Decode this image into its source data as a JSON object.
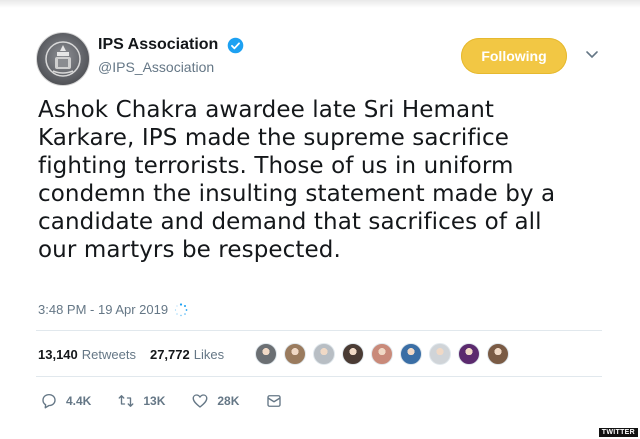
{
  "account": {
    "display_name": "IPS Association",
    "handle": "@IPS_Association",
    "verified": true,
    "avatar_icon": "police-emblem-icon"
  },
  "follow_button": {
    "label": "Following",
    "color": "#f2c744"
  },
  "menu": {
    "icon": "chevron-down-icon"
  },
  "tweet": {
    "lines": [
      "Ashok Chakra awardee late Sri Hemant",
      "Karkare, IPS made the supreme sacrifice",
      "fighting terrorists. Those of us in uniform",
      "condemn the insulting statement made by a",
      "candidate and demand that sacrifices of all",
      "our martyrs be respected."
    ],
    "timestamp": "3:48 PM - 19 Apr 2019"
  },
  "stats": {
    "retweets_count": "13,140",
    "retweets_label": "Retweets",
    "likes_count": "27,772",
    "likes_label": "Likes"
  },
  "liker_avatars": [
    {
      "color": "#6b6f73"
    },
    {
      "color": "#9a7b5e"
    },
    {
      "color": "#b8bec4"
    },
    {
      "color": "#4a3b34"
    },
    {
      "color": "#c98a7a"
    },
    {
      "color": "#3a6ea5"
    },
    {
      "color": "#d0d4d8"
    },
    {
      "color": "#5b2a6e"
    },
    {
      "color": "#7a5b45"
    }
  ],
  "actions": {
    "reply_count": "4.4K",
    "retweet_count": "13K",
    "like_count": "28K"
  },
  "watermark": "TWITTER",
  "colors": {
    "verified_blue": "#1da1f2",
    "secondary_text": "#657786"
  }
}
